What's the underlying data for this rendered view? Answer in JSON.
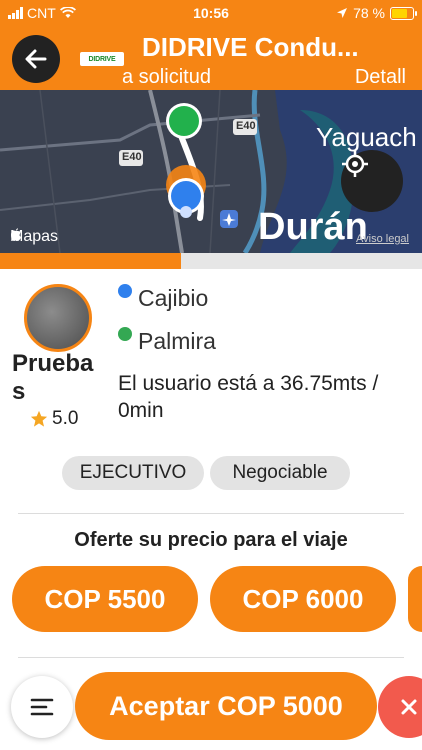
{
  "status_bar": {
    "carrier": "CNT",
    "time": "10:56",
    "battery": "78 %",
    "battery_level": 0.78
  },
  "header": {
    "title": "DIDRIVE Condu...",
    "subtitle": "a solicitud",
    "detail": "Detall",
    "logo_text": "DIDRIVE",
    "icons": {
      "back": "arrow-left-icon"
    }
  },
  "map": {
    "attribution": "Mapas",
    "legal": "Aviso legal",
    "labels": {
      "city_main": "Durán",
      "city_side": "Yaguach",
      "road_1": "E40",
      "road_2": "E40"
    },
    "icons": {
      "locate": "crosshair-icon",
      "airport": "airplane-icon"
    }
  },
  "trip_progress": 0.43,
  "user": {
    "name": "Pruebas",
    "rating": "5.0"
  },
  "route": {
    "origin": "Cajibio",
    "origin_color": "#2f80ed",
    "destination": "Palmira",
    "destination_color": "#34a853",
    "distance_text": "El usuario está a 36.75mts / 0min"
  },
  "tags": [
    "EJECUTIVO",
    "Negociable"
  ],
  "offer": {
    "title": "Oferte su precio para el viaje",
    "prices": [
      "COP 5500",
      "COP 6000"
    ]
  },
  "actions": {
    "accept": "Aceptar COP 5000",
    "menu_icon": "menu-lines-icon",
    "close_icon": "close-icon"
  },
  "colors": {
    "accent": "#f68514",
    "danger": "#f25a4d"
  }
}
